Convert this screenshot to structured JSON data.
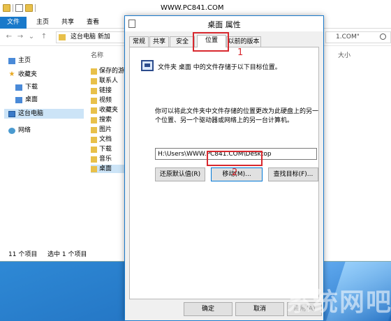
{
  "explorer": {
    "title": "WWW.PC841.COM",
    "ribbon_tabs": [
      "文件",
      "主页",
      "共享",
      "查看"
    ],
    "address": "这台电脑  新加",
    "search_value": "1.COM\"",
    "col_name": "名称",
    "col_size": "大小",
    "nav_items": [
      "主页",
      "收藏夹",
      "下载",
      "桌面",
      "这台电脑",
      "网络"
    ],
    "files": [
      "保存的游",
      "联系人",
      "链接",
      "视频",
      "收藏夹",
      "搜索",
      "图片",
      "文档",
      "下载",
      "音乐",
      "桌面"
    ],
    "status_count": "11 个项目",
    "status_selected": "选中 1 个项目"
  },
  "dialog": {
    "title": "桌面 属性",
    "tabs": [
      "常规",
      "共享",
      "安全",
      "位置",
      "以前的版本"
    ],
    "active_tab": "位置",
    "location_header": "文件夹 桌面 中的文件存储于以下目标位置。",
    "description": "你可以将此文件夹中文件存储的位置更改为此硬盘上的另一个位置、另一个驱动器或网络上的另一台计算机。",
    "path_value": "H:\\Users\\WWW.PC841.COM\\Desktop",
    "restore_default": "还原默认值(R)",
    "move": "移动(M)...",
    "find_target": "查找目标(F)...",
    "ok": "确定",
    "cancel": "取消",
    "apply": "应用(A)"
  },
  "markers": {
    "one": "1",
    "two": "2"
  },
  "watermark": "系统网吧",
  "colors": {
    "accent": "#1979ca",
    "marker_red": "#d8282e",
    "desktop_blue": "#2a78c6"
  }
}
